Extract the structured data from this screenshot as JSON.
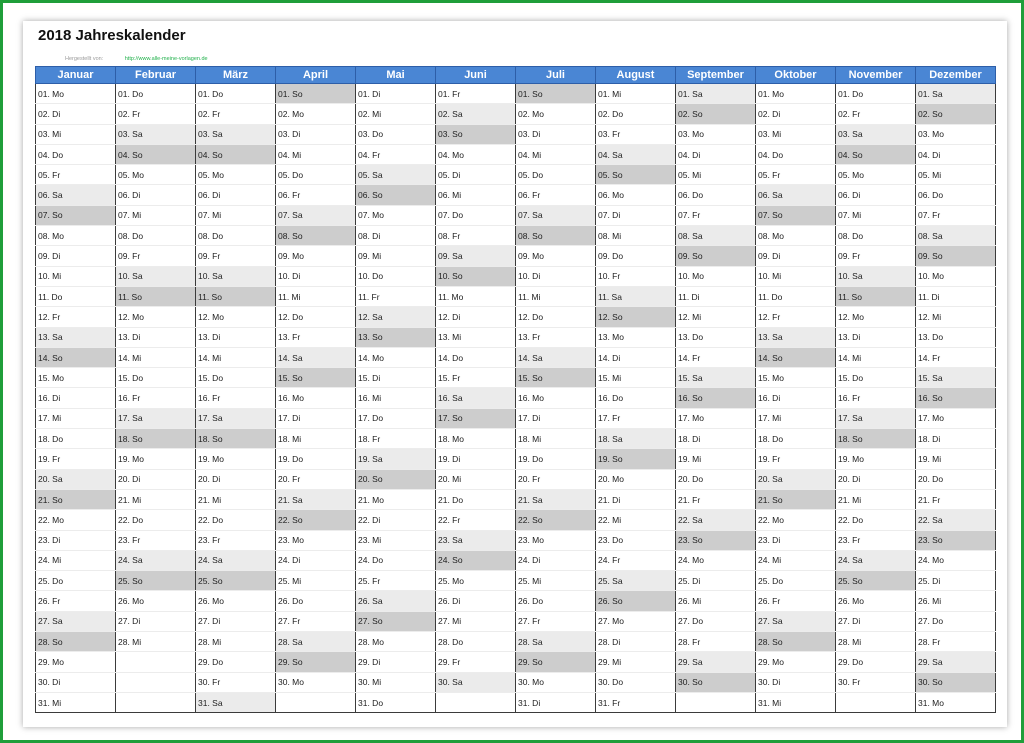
{
  "title": "2018 Jahreskalender",
  "credit": {
    "text": "Hergestellt von:",
    "url": "http://www.alle-meine-vorlagen.de"
  },
  "colors": {
    "header": "#4a86d4",
    "saturday": "#ebebeb",
    "sunday": "#cdcdcd",
    "frame": "#1f9e3a"
  },
  "months": [
    {
      "name": "Januar",
      "days": [
        "01. Mo",
        "02. Di",
        "03. Mi",
        "04. Do",
        "05. Fr",
        "06. Sa",
        "07. So",
        "08. Mo",
        "09. Di",
        "10. Mi",
        "11. Do",
        "12. Fr",
        "13. Sa",
        "14. So",
        "15. Mo",
        "16. Di",
        "17. Mi",
        "18. Do",
        "19. Fr",
        "20. Sa",
        "21. So",
        "22. Mo",
        "23. Di",
        "24. Mi",
        "25. Do",
        "26. Fr",
        "27. Sa",
        "28. So",
        "29. Mo",
        "30. Di",
        "31. Mi"
      ]
    },
    {
      "name": "Februar",
      "days": [
        "01. Do",
        "02. Fr",
        "03. Sa",
        "04. So",
        "05. Mo",
        "06. Di",
        "07. Mi",
        "08. Do",
        "09. Fr",
        "10. Sa",
        "11. So",
        "12. Mo",
        "13. Di",
        "14. Mi",
        "15. Do",
        "16. Fr",
        "17. Sa",
        "18. So",
        "19. Mo",
        "20. Di",
        "21. Mi",
        "22. Do",
        "23. Fr",
        "24. Sa",
        "25. So",
        "26. Mo",
        "27. Di",
        "28. Mi"
      ]
    },
    {
      "name": "März",
      "days": [
        "01. Do",
        "02. Fr",
        "03. Sa",
        "04. So",
        "05. Mo",
        "06. Di",
        "07. Mi",
        "08. Do",
        "09. Fr",
        "10. Sa",
        "11. So",
        "12. Mo",
        "13. Di",
        "14. Mi",
        "15. Do",
        "16. Fr",
        "17. Sa",
        "18. So",
        "19. Mo",
        "20. Di",
        "21. Mi",
        "22. Do",
        "23. Fr",
        "24. Sa",
        "25. So",
        "26. Mo",
        "27. Di",
        "28. Mi",
        "29. Do",
        "30. Fr",
        "31. Sa"
      ]
    },
    {
      "name": "April",
      "days": [
        "01. So",
        "02. Mo",
        "03. Di",
        "04. Mi",
        "05. Do",
        "06. Fr",
        "07. Sa",
        "08. So",
        "09. Mo",
        "10. Di",
        "11. Mi",
        "12. Do",
        "13. Fr",
        "14. Sa",
        "15. So",
        "16. Mo",
        "17. Di",
        "18. Mi",
        "19. Do",
        "20. Fr",
        "21. Sa",
        "22. So",
        "23. Mo",
        "24. Di",
        "25. Mi",
        "26. Do",
        "27. Fr",
        "28. Sa",
        "29. So",
        "30. Mo"
      ]
    },
    {
      "name": "Mai",
      "days": [
        "01. Di",
        "02. Mi",
        "03. Do",
        "04. Fr",
        "05. Sa",
        "06. So",
        "07. Mo",
        "08. Di",
        "09. Mi",
        "10. Do",
        "11. Fr",
        "12. Sa",
        "13. So",
        "14. Mo",
        "15. Di",
        "16. Mi",
        "17. Do",
        "18. Fr",
        "19. Sa",
        "20. So",
        "21. Mo",
        "22. Di",
        "23. Mi",
        "24. Do",
        "25. Fr",
        "26. Sa",
        "27. So",
        "28. Mo",
        "29. Di",
        "30. Mi",
        "31. Do"
      ]
    },
    {
      "name": "Juni",
      "days": [
        "01. Fr",
        "02. Sa",
        "03. So",
        "04. Mo",
        "05. Di",
        "06. Mi",
        "07. Do",
        "08. Fr",
        "09. Sa",
        "10. So",
        "11. Mo",
        "12. Di",
        "13. Mi",
        "14. Do",
        "15. Fr",
        "16. Sa",
        "17. So",
        "18. Mo",
        "19. Di",
        "20. Mi",
        "21. Do",
        "22. Fr",
        "23. Sa",
        "24. So",
        "25. Mo",
        "26. Di",
        "27. Mi",
        "28. Do",
        "29. Fr",
        "30. Sa"
      ]
    },
    {
      "name": "Juli",
      "days": [
        "01. So",
        "02. Mo",
        "03. Di",
        "04. Mi",
        "05. Do",
        "06. Fr",
        "07. Sa",
        "08. So",
        "09. Mo",
        "10. Di",
        "11. Mi",
        "12. Do",
        "13. Fr",
        "14. Sa",
        "15. So",
        "16. Mo",
        "17. Di",
        "18. Mi",
        "19. Do",
        "20. Fr",
        "21. Sa",
        "22. So",
        "23. Mo",
        "24. Di",
        "25. Mi",
        "26. Do",
        "27. Fr",
        "28. Sa",
        "29. So",
        "30. Mo",
        "31. Di"
      ]
    },
    {
      "name": "August",
      "days": [
        "01. Mi",
        "02. Do",
        "03. Fr",
        "04. Sa",
        "05. So",
        "06. Mo",
        "07. Di",
        "08. Mi",
        "09. Do",
        "10. Fr",
        "11. Sa",
        "12. So",
        "13. Mo",
        "14. Di",
        "15. Mi",
        "16. Do",
        "17. Fr",
        "18. Sa",
        "19. So",
        "20. Mo",
        "21. Di",
        "22. Mi",
        "23. Do",
        "24. Fr",
        "25. Sa",
        "26. So",
        "27. Mo",
        "28. Di",
        "29. Mi",
        "30. Do",
        "31. Fr"
      ]
    },
    {
      "name": "September",
      "days": [
        "01. Sa",
        "02. So",
        "03. Mo",
        "04. Di",
        "05. Mi",
        "06. Do",
        "07. Fr",
        "08. Sa",
        "09. So",
        "10. Mo",
        "11. Di",
        "12. Mi",
        "13. Do",
        "14. Fr",
        "15. Sa",
        "16. So",
        "17. Mo",
        "18. Di",
        "19. Mi",
        "20. Do",
        "21. Fr",
        "22. Sa",
        "23. So",
        "24. Mo",
        "25. Di",
        "26. Mi",
        "27. Do",
        "28. Fr",
        "29. Sa",
        "30. So"
      ]
    },
    {
      "name": "Oktober",
      "days": [
        "01. Mo",
        "02. Di",
        "03. Mi",
        "04. Do",
        "05. Fr",
        "06. Sa",
        "07. So",
        "08. Mo",
        "09. Di",
        "10. Mi",
        "11. Do",
        "12. Fr",
        "13. Sa",
        "14. So",
        "15. Mo",
        "16. Di",
        "17. Mi",
        "18. Do",
        "19. Fr",
        "20. Sa",
        "21. So",
        "22. Mo",
        "23. Di",
        "24. Mi",
        "25. Do",
        "26. Fr",
        "27. Sa",
        "28. So",
        "29. Mo",
        "30. Di",
        "31. Mi"
      ]
    },
    {
      "name": "November",
      "days": [
        "01. Do",
        "02. Fr",
        "03. Sa",
        "04. So",
        "05. Mo",
        "06. Di",
        "07. Mi",
        "08. Do",
        "09. Fr",
        "10. Sa",
        "11. So",
        "12. Mo",
        "13. Di",
        "14. Mi",
        "15. Do",
        "16. Fr",
        "17. Sa",
        "18. So",
        "19. Mo",
        "20. Di",
        "21. Mi",
        "22. Do",
        "23. Fr",
        "24. Sa",
        "25. So",
        "26. Mo",
        "27. Di",
        "28. Mi",
        "29. Do",
        "30. Fr"
      ]
    },
    {
      "name": "Dezember",
      "days": [
        "01. Sa",
        "02. So",
        "03. Mo",
        "04. Di",
        "05. Mi",
        "06. Do",
        "07. Fr",
        "08. Sa",
        "09. So",
        "10. Mo",
        "11. Di",
        "12. Mi",
        "13. Do",
        "14. Fr",
        "15. Sa",
        "16. So",
        "17. Mo",
        "18. Di",
        "19. Mi",
        "20. Do",
        "21. Fr",
        "22. Sa",
        "23. So",
        "24. Mo",
        "25. Di",
        "26. Mi",
        "27. Do",
        "28. Fr",
        "29. Sa",
        "30. So",
        "31. Mo"
      ]
    }
  ]
}
